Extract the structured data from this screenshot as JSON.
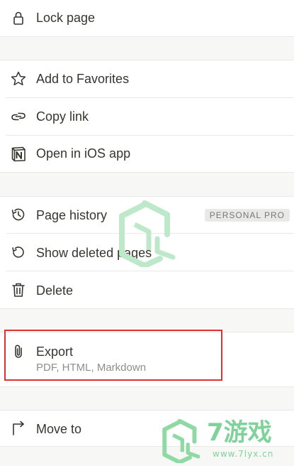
{
  "menu": {
    "lock_page": "Lock page",
    "add_to_favorites": "Add to Favorites",
    "copy_link": "Copy link",
    "open_in_ios_app": "Open in iOS app",
    "page_history": "Page history",
    "page_history_badge": "PERSONAL PRO",
    "show_deleted_pages": "Show deleted pages",
    "delete": "Delete",
    "export": "Export",
    "export_subtitle": "PDF, HTML, Markdown",
    "move_to": "Move to"
  },
  "icons": {
    "lock_page": "lock-icon",
    "add_to_favorites": "star-icon",
    "copy_link": "link-icon",
    "open_in_ios_app": "notion-app-icon",
    "page_history": "history-icon",
    "show_deleted_pages": "restore-icon",
    "delete": "trash-icon",
    "export": "paperclip-icon",
    "move_to": "move-arrow-icon"
  },
  "watermark": {
    "brand": "7游戏",
    "url": "www.7lyx.cn"
  },
  "colors": {
    "text": "#37352f",
    "secondary_text": "#8f8e8a",
    "separator_band": "#f7f7f5",
    "highlight": "#e03131",
    "watermark": "#7fd39a"
  }
}
